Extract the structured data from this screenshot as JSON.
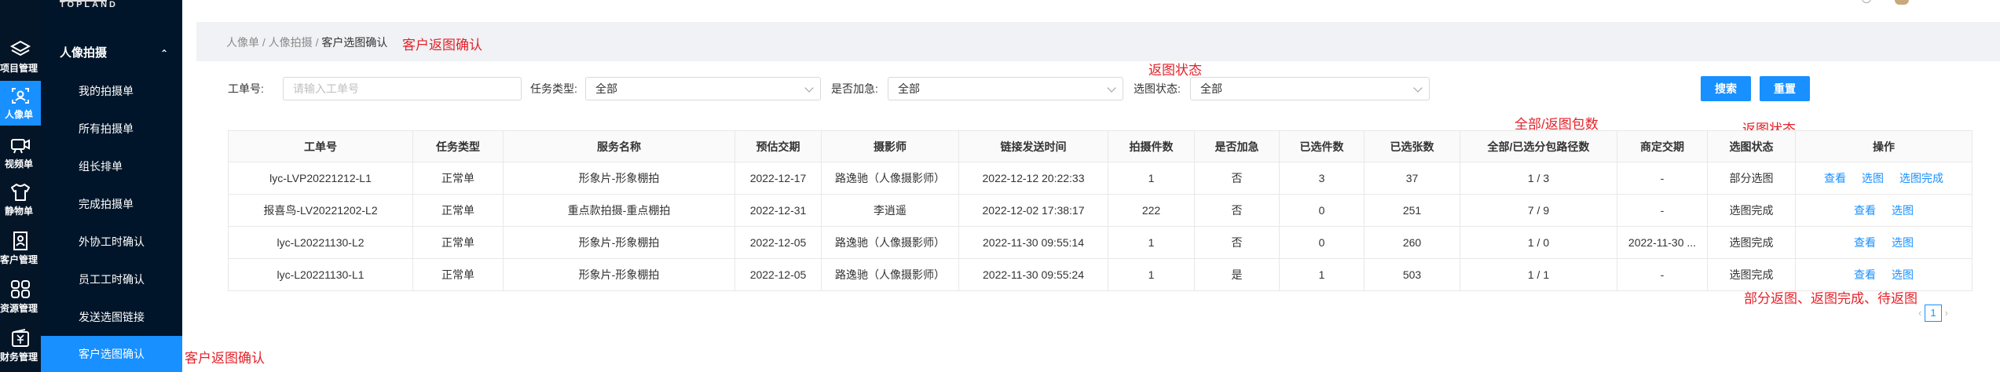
{
  "brand": {
    "logo_text": "TOPLAND"
  },
  "rail": [
    {
      "label": "项目管理",
      "icon": "layers-icon",
      "active": false
    },
    {
      "label": "人像单",
      "icon": "person-frame-icon",
      "active": true
    },
    {
      "label": "视频单",
      "icon": "video-camera-icon",
      "active": false
    },
    {
      "label": "静物单",
      "icon": "tshirt-icon",
      "active": false
    },
    {
      "label": "客户管理",
      "icon": "id-card-icon",
      "active": false
    },
    {
      "label": "资源管理",
      "icon": "grid-icon",
      "active": false
    },
    {
      "label": "财务管理",
      "icon": "yen-wallet-icon",
      "active": false
    }
  ],
  "submenu": {
    "title": "人像拍摄",
    "items": [
      "我的拍摄单",
      "所有拍摄单",
      "组长排单",
      "完成拍摄单",
      "外协工时确认",
      "员工工时确认",
      "发送选图链接",
      "客户选图确认"
    ],
    "active_index": 7
  },
  "breadcrumb": {
    "items": [
      "人像单",
      "人像拍摄"
    ],
    "separator": "/",
    "current": "客户选图确认"
  },
  "annotations": {
    "breadcrumb_note": "客户返图确认",
    "status_note_top": "返图状态",
    "count_note": "全部/返图包数",
    "status_note_table": "返图状态",
    "status_values_note": "部分返图、返图完成、待返图",
    "menu_note": "客户返图确认"
  },
  "filters": {
    "order_no": {
      "label": "工单号:",
      "placeholder": "请输入工单号"
    },
    "task_type": {
      "label": "任务类型:",
      "value": "全部"
    },
    "urgent": {
      "label": "是否加急:",
      "value": "全部"
    },
    "select_status": {
      "label": "选图状态:",
      "value": "全部"
    },
    "search_button": "搜索",
    "reset_button": "重置"
  },
  "table": {
    "columns": [
      "工单号",
      "任务类型",
      "服务名称",
      "预估交期",
      "摄影师",
      "链接发送时间",
      "拍摄件数",
      "是否加急",
      "已选件数",
      "已选张数",
      "全部/已选分包路径数",
      "商定交期",
      "选图状态",
      "操作"
    ],
    "rows": [
      {
        "cells": [
          "lyc-LVP20221212-L1",
          "正常单",
          "形象片-形象棚拍",
          "2022-12-17",
          "路逸驰（人像摄影师）",
          "2022-12-12 20:22:33",
          "1",
          "否",
          "3",
          "37",
          "1 / 3",
          "-",
          "部分选图"
        ],
        "actions": [
          "查看",
          "选图",
          "选图完成"
        ]
      },
      {
        "cells": [
          "报喜鸟-LV20221202-L2",
          "正常单",
          "重点款拍摄-重点棚拍",
          "2022-12-31",
          "李逍遥",
          "2022-12-02 17:38:17",
          "222",
          "否",
          "0",
          "251",
          "7 / 9",
          "-",
          "选图完成"
        ],
        "actions": [
          "查看",
          "选图"
        ]
      },
      {
        "cells": [
          "lyc-L20221130-L2",
          "正常单",
          "形象片-形象棚拍",
          "2022-12-05",
          "路逸驰（人像摄影师）",
          "2022-11-30 09:55:14",
          "1",
          "否",
          "0",
          "260",
          "1 / 0",
          "2022-11-30 ...",
          "选图完成"
        ],
        "actions": [
          "查看",
          "选图"
        ]
      },
      {
        "cells": [
          "lyc-L20221130-L1",
          "正常单",
          "形象片-形象棚拍",
          "2022-12-05",
          "路逸驰（人像摄影师）",
          "2022-11-30 09:55:24",
          "1",
          "是",
          "1",
          "503",
          "1 / 1",
          "-",
          "选图完成"
        ],
        "actions": [
          "查看",
          "选图"
        ]
      }
    ]
  },
  "pagination": {
    "prev": "‹",
    "current": "1",
    "next": "›"
  }
}
